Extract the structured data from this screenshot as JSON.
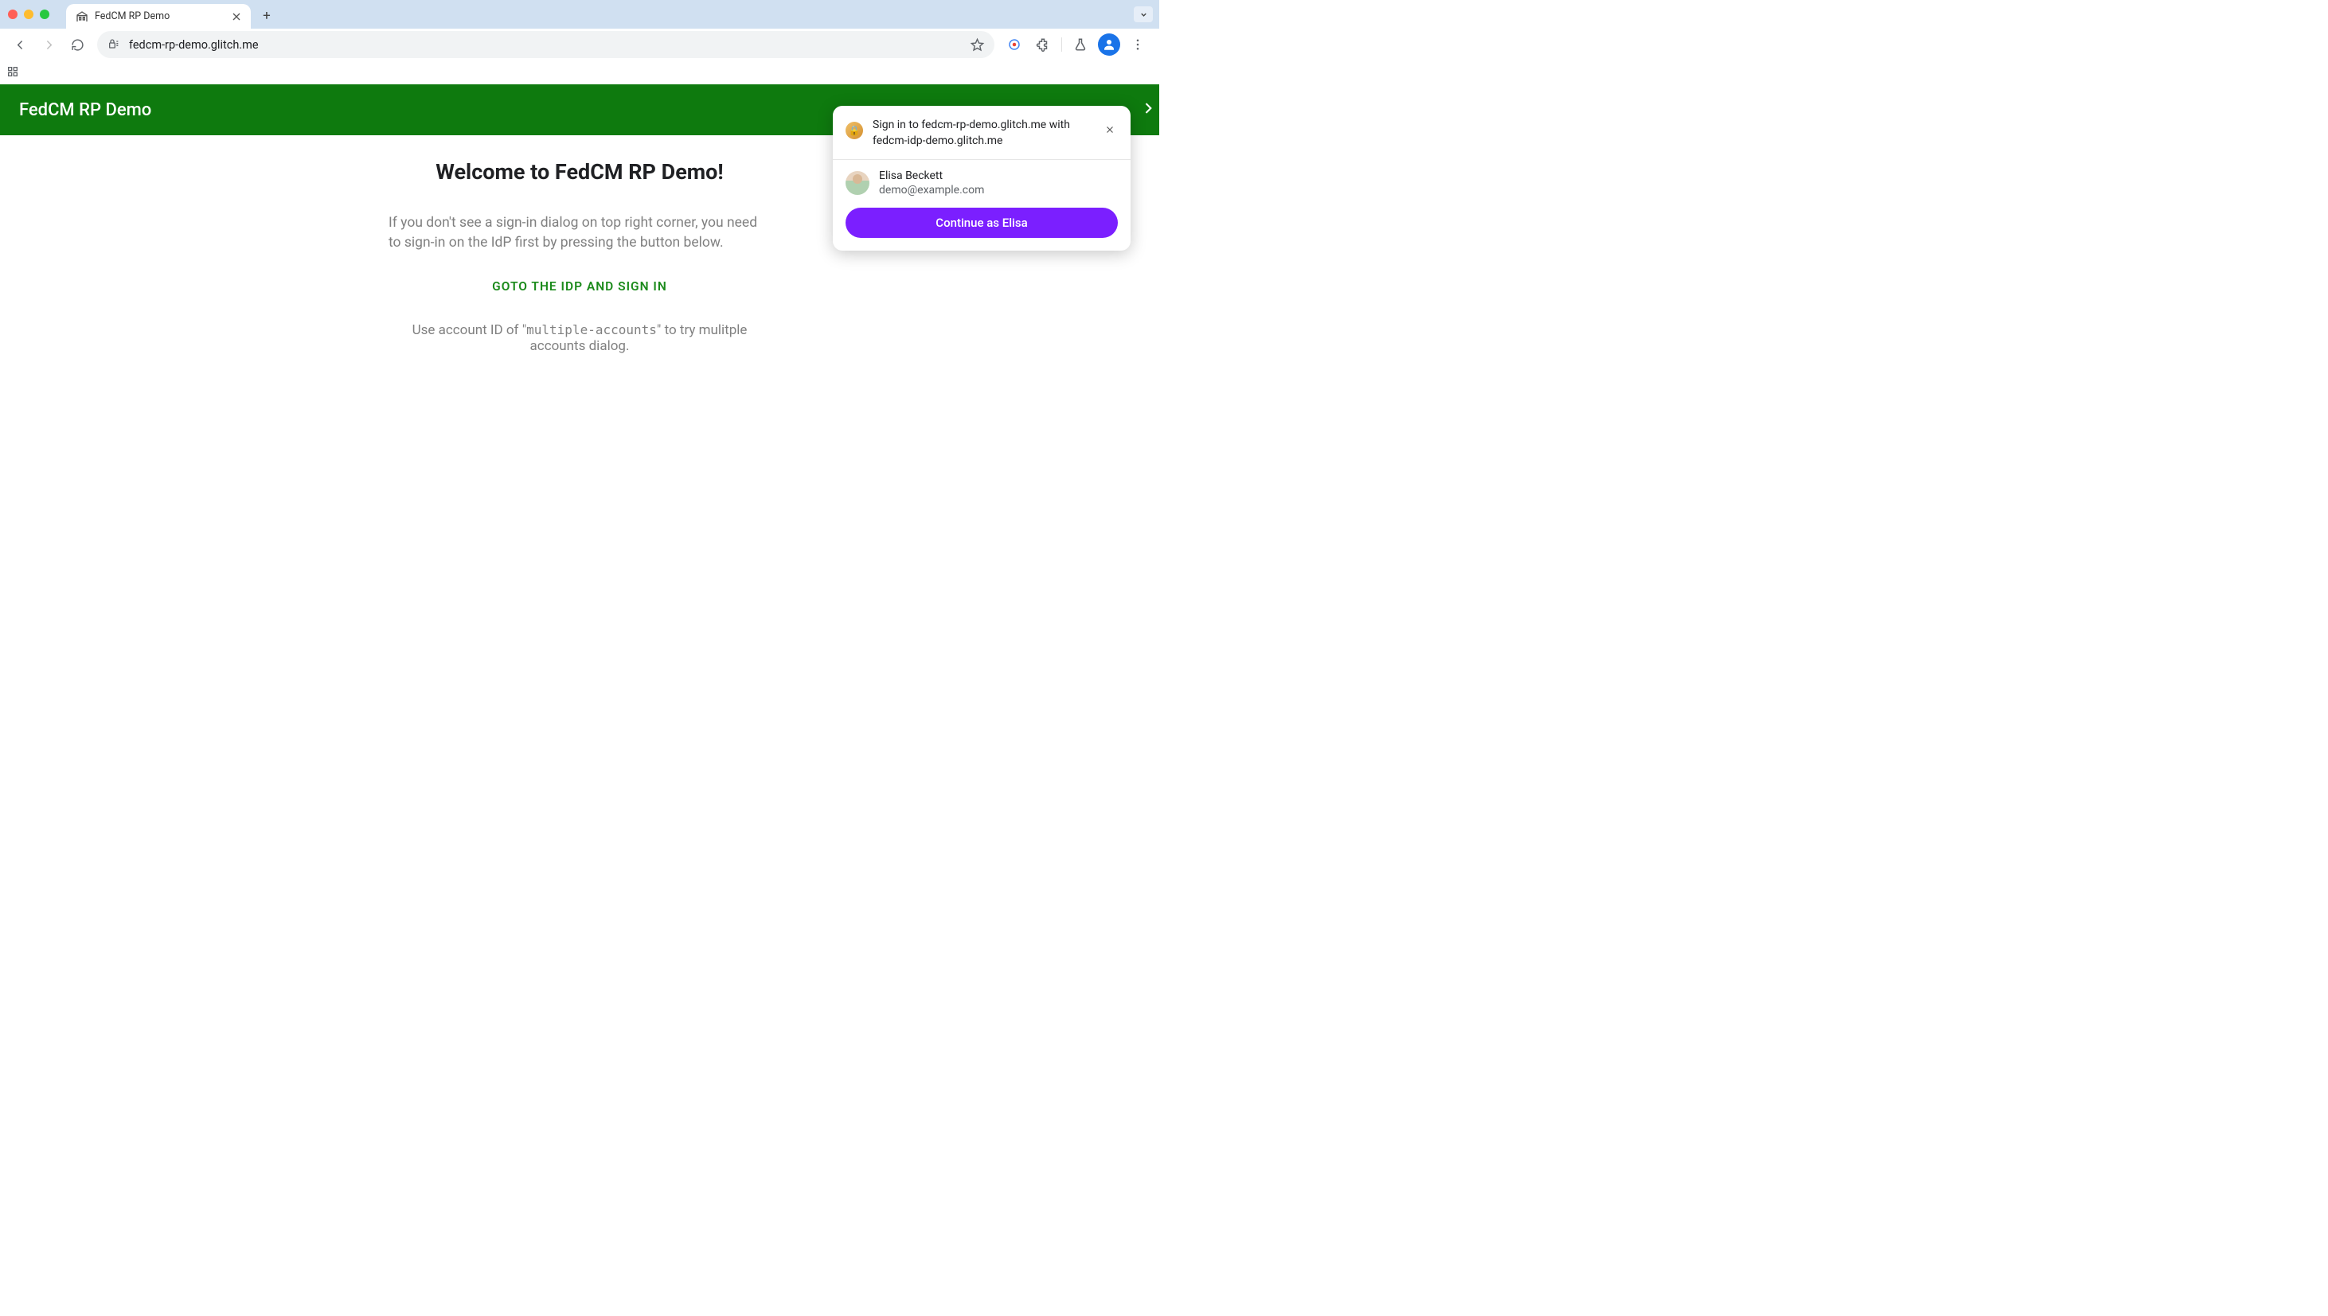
{
  "tab": {
    "title": "FedCM RP Demo"
  },
  "address_bar": {
    "url": "fedcm-rp-demo.glitch.me"
  },
  "app_header": {
    "title": "FedCM RP Demo"
  },
  "main": {
    "welcome": "Welcome to FedCM RP Demo!",
    "description": "If you don't see a sign-in dialog on top right corner, you need to sign-in on the IdP first by pressing the button below.",
    "idp_button": "GOTO THE IDP AND SIGN IN",
    "note_prefix": "Use account ID of \"",
    "note_code": "multiple-accounts",
    "note_suffix": "\" to try mulitple accounts dialog."
  },
  "fedcm": {
    "title": "Sign in to fedcm-rp-demo.glitch.me with fedcm-idp-demo.glitch.me",
    "account": {
      "name": "Elisa Beckett",
      "email": "demo@example.com"
    },
    "continue_label": "Continue as Elisa"
  }
}
